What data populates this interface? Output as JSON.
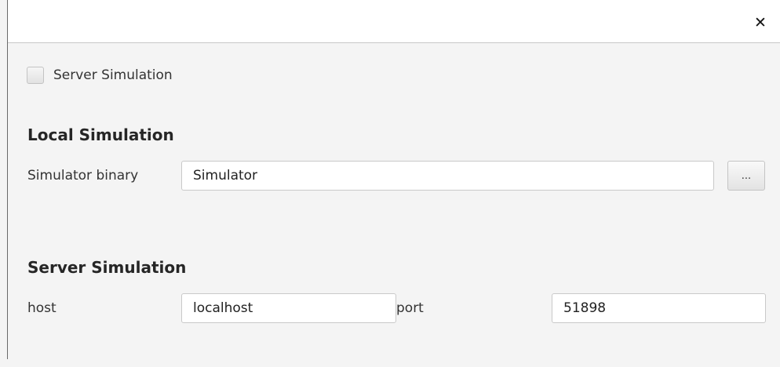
{
  "dialog": {
    "close_glyph": "✕"
  },
  "server_simulation_toggle": {
    "label": "Server Simulation",
    "checked": false
  },
  "local_simulation": {
    "heading": "Local Simulation",
    "binary_label": "Simulator binary",
    "binary_value": "Simulator",
    "browse_label": "..."
  },
  "server_simulation": {
    "heading": "Server Simulation",
    "host_label": "host",
    "host_value": "localhost",
    "port_label": "port",
    "port_value": "51898"
  },
  "icons": {
    "close": "close-icon"
  }
}
